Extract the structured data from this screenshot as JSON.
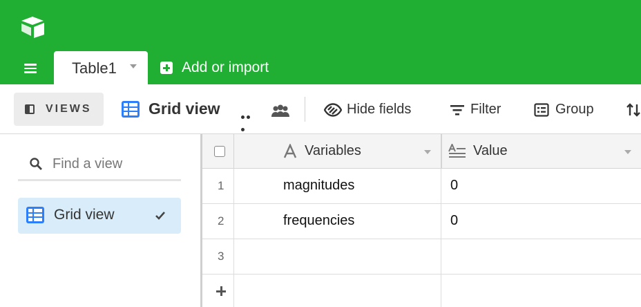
{
  "app": {
    "brand_color": "#20ae33",
    "logo_icon": "airtable-logo-icon",
    "menu_icon": "hamburger-menu-icon"
  },
  "tabs": [
    {
      "label": "Table1",
      "active": true,
      "dropdown_icon": "caret-down-icon"
    }
  ],
  "add_import": {
    "label": "Add or import",
    "icon": "plus-square-icon"
  },
  "toolbar": {
    "views_label": "VIEWS",
    "current_view": "Grid view",
    "more_icon": "more-dots-icon",
    "collaborators_icon": "people-icon",
    "hide_fields_label": "Hide fields",
    "filter_label": "Filter",
    "group_label": "Group",
    "sort_icon": "sort-icon"
  },
  "sidebar": {
    "search_placeholder": "Find a view",
    "views": [
      {
        "label": "Grid view",
        "icon": "grid-view-icon",
        "selected": true
      }
    ]
  },
  "grid": {
    "columns": [
      {
        "label": "Variables",
        "type_icon": "single-line-text-icon"
      },
      {
        "label": "Value",
        "type_icon": "long-text-icon"
      }
    ],
    "rows": [
      {
        "num": "1",
        "cells": [
          "magnitudes",
          "0"
        ]
      },
      {
        "num": "2",
        "cells": [
          "frequencies",
          "0"
        ]
      },
      {
        "num": "3",
        "cells": [
          "",
          ""
        ]
      }
    ],
    "add_row_icon": "plus-icon"
  }
}
